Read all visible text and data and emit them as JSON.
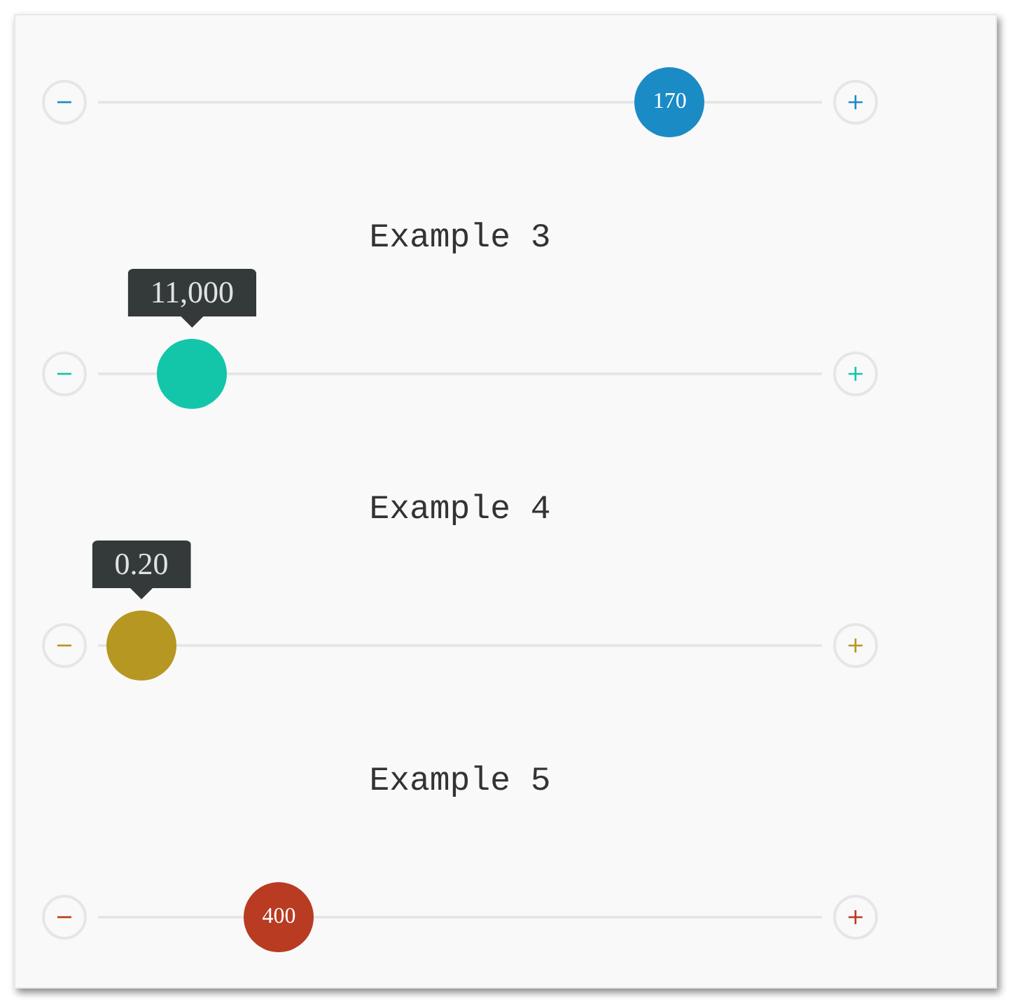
{
  "sliders": [
    {
      "color": "#1b8bc6",
      "level": 0.79,
      "value": "170",
      "minus": "−",
      "plus": "+"
    },
    {
      "heading": "Example 3",
      "color": "#13c6aa",
      "level": 0.13,
      "tooltip": "11,000",
      "minus": "−",
      "plus": "+"
    },
    {
      "heading": "Example 4",
      "color": "#b59722",
      "level": 0.06,
      "tooltip": "0.20",
      "minus": "−",
      "plus": "+"
    },
    {
      "heading": "Example 5",
      "color": "#b83b22",
      "level": 0.25,
      "value": "400",
      "minus": "−",
      "plus": "+"
    }
  ]
}
